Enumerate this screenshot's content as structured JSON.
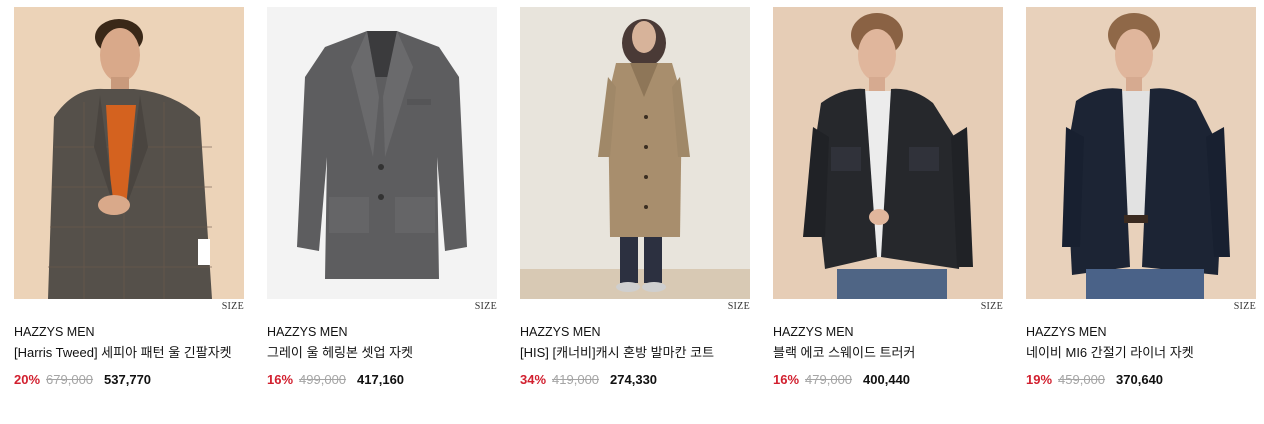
{
  "colors": {
    "discount": "#d2202f",
    "original_price": "#a5a5a5",
    "text": "#111111"
  },
  "products": [
    {
      "image": "model-tweed-jacket-photo",
      "size_label": "SIZE",
      "brand": "HAZZYS MEN",
      "name": "[Harris Tweed] 세피아 패턴 울 긴팔자켓",
      "discount": "20%",
      "original_price": "679,000",
      "sale_price": "537,770"
    },
    {
      "image": "gray-herringbone-jacket-photo",
      "size_label": "SIZE",
      "brand": "HAZZYS MEN",
      "name": "그레이 울 헤링본 셋업 자켓",
      "discount": "16%",
      "original_price": "499,000",
      "sale_price": "417,160"
    },
    {
      "image": "model-camel-balmacaan-coat-photo",
      "size_label": "SIZE",
      "brand": "HAZZYS MEN",
      "name": "[HIS] [캐너비]캐시 혼방 발마칸 코트",
      "discount": "34%",
      "original_price": "419,000",
      "sale_price": "274,330"
    },
    {
      "image": "model-black-trucker-jacket-photo",
      "size_label": "SIZE",
      "brand": "HAZZYS MEN",
      "name": "블랙 에코 스웨이드 트러커",
      "discount": "16%",
      "original_price": "479,000",
      "sale_price": "400,440"
    },
    {
      "image": "model-navy-liner-jacket-photo",
      "size_label": "SIZE",
      "brand": "HAZZYS MEN",
      "name": "네이비 MI6 간절기 라이너 자켓",
      "discount": "19%",
      "original_price": "459,000",
      "sale_price": "370,640"
    }
  ]
}
